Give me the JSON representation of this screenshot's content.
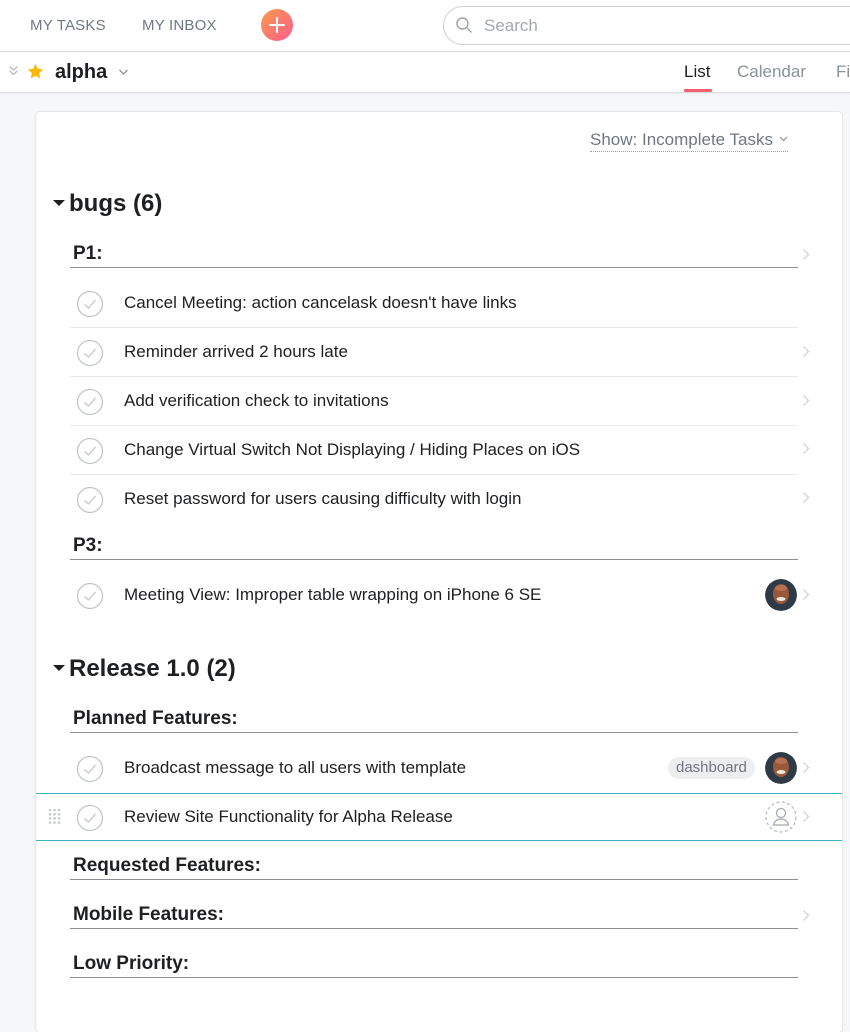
{
  "topbar": {
    "my_tasks": "MY TASKS",
    "my_inbox": "MY INBOX",
    "add_icon": "plus-circle-icon",
    "search_placeholder": "Search",
    "search_value": "",
    "colors": {
      "add_gradient_start": "#fc9a4a",
      "add_gradient_end": "#f95d8f"
    }
  },
  "project": {
    "name": "alpha",
    "starred": true,
    "star_color": "#f8b900",
    "tabs": [
      {
        "label": "List",
        "active": true
      },
      {
        "label": "Calendar",
        "active": false
      },
      {
        "label": "Fi",
        "active": false
      }
    ],
    "active_tab_color": "#f0616d"
  },
  "filter": {
    "label": "Show: Incomplete Tasks"
  },
  "sections": [
    {
      "title": "bugs (6)",
      "groups": [
        {
          "label": "P1:",
          "tasks": [
            {
              "name": "Cancel Meeting: action cancelask doesn't have links"
            },
            {
              "name": "Reminder arrived 2 hours late"
            },
            {
              "name": "Add verification check to invitations"
            },
            {
              "name": "Change Virtual Switch Not Displaying / Hiding Places on iOS"
            },
            {
              "name": "Reset password for users causing difficulty with login"
            }
          ]
        },
        {
          "label": "P3:",
          "tasks": [
            {
              "name": "Meeting View: Improper table wrapping on iPhone 6 SE",
              "assignee": "avatar-photo"
            }
          ]
        }
      ]
    },
    {
      "title": "Release 1.0 (2)",
      "groups": [
        {
          "label": "Planned Features:",
          "tasks": [
            {
              "name": "Broadcast message to all users with template",
              "tag": "dashboard",
              "assignee": "avatar-photo"
            },
            {
              "name": "Review Site Functionality for Alpha Release",
              "assignee": "unassigned",
              "selected": true
            }
          ]
        },
        {
          "label": "Requested Features:",
          "tasks": []
        },
        {
          "label": "Mobile Features:",
          "tasks": []
        },
        {
          "label": "Low Priority:",
          "tasks": []
        }
      ]
    }
  ],
  "selection_color": "#3fb5c4"
}
